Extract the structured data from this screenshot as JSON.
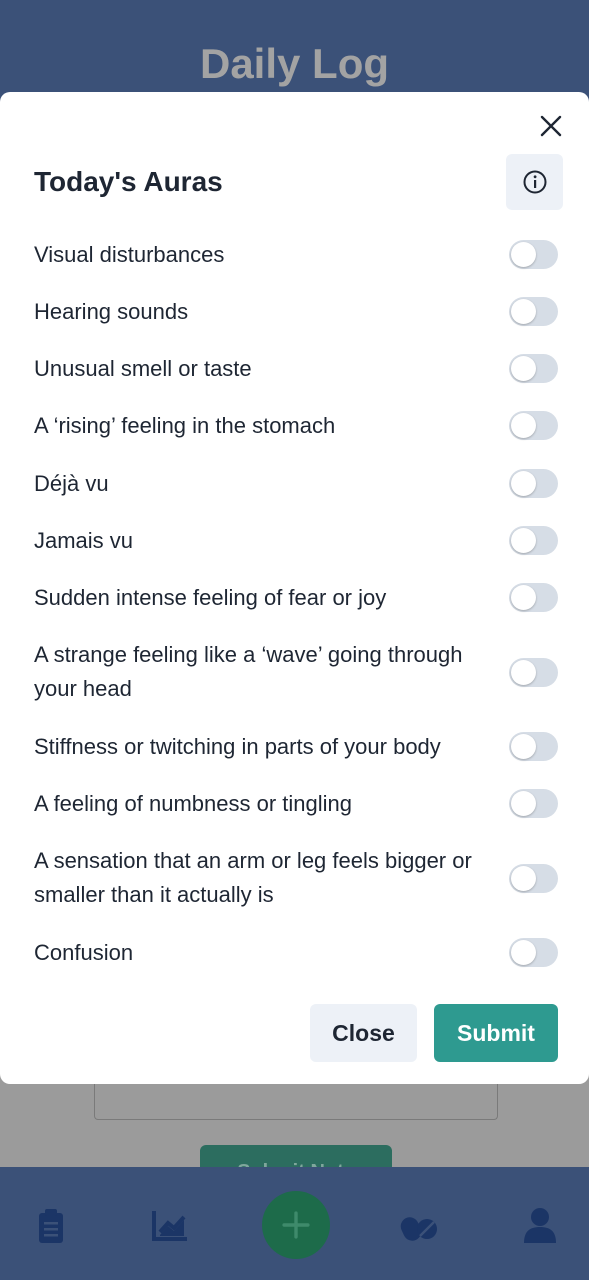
{
  "app": {
    "title": "Daily Log",
    "bg_submit_label": "Submit Note"
  },
  "tab_bar": {
    "icons": [
      "clipboard-icon",
      "chart-icon",
      "plus-icon",
      "pills-icon",
      "user-icon"
    ]
  },
  "modal": {
    "title": "Today's Auras",
    "close_label": "Close",
    "submit_label": "Submit",
    "auras": [
      {
        "label": "Visual disturbances",
        "on": false
      },
      {
        "label": "Hearing sounds",
        "on": false
      },
      {
        "label": "Unusual smell or taste",
        "on": false
      },
      {
        "label": "A ‘rising’ feeling in the stomach",
        "on": false
      },
      {
        "label": "Déjà vu",
        "on": false
      },
      {
        "label": "Jamais vu",
        "on": false
      },
      {
        "label": "Sudden intense feeling of fear or joy",
        "on": false
      },
      {
        "label": "A strange feeling like a ‘wave’ going through your head",
        "on": false
      },
      {
        "label": "Stiffness or twitching in parts of your body",
        "on": false
      },
      {
        "label": "A feeling of numbness or tingling",
        "on": false
      },
      {
        "label": "A sensation that an arm or leg feels bigger or smaller than it actually is",
        "on": false
      },
      {
        "label": "Confusion",
        "on": false
      }
    ]
  },
  "colors": {
    "header": "#3b5178",
    "accent": "#2e9a90",
    "toggle_off": "#d6dde6"
  }
}
